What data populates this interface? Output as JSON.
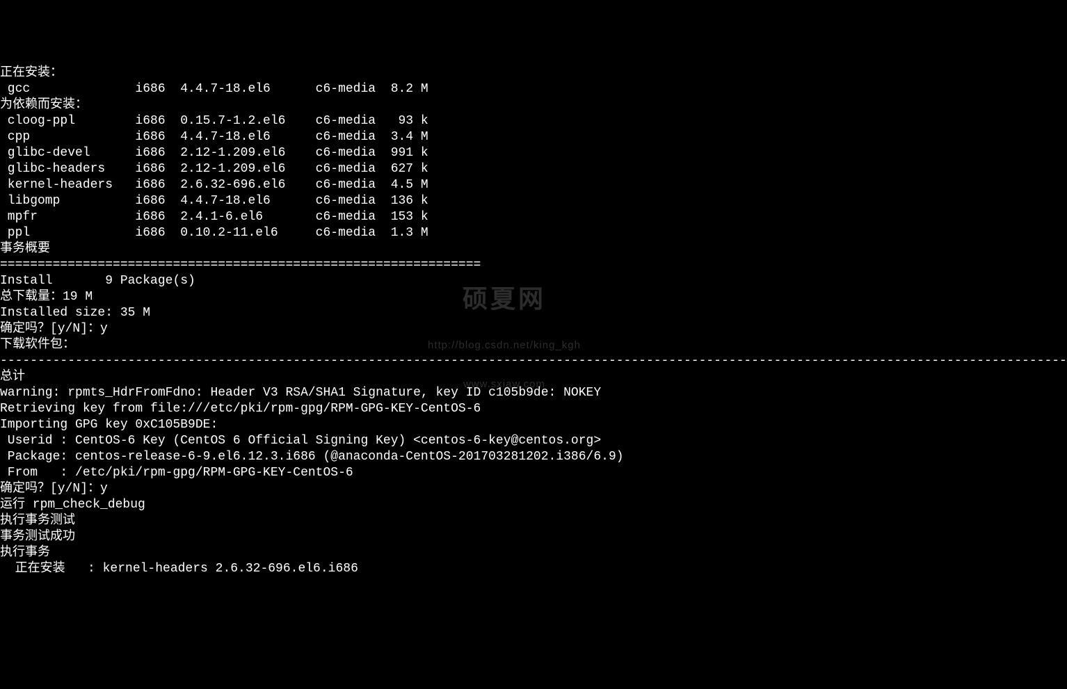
{
  "headers": {
    "installing": "正在安装：",
    "depInstalling": "为依赖而安装：",
    "transactionSummary": "事务概要",
    "total": "总计"
  },
  "pkg_install": [
    {
      "name": "gcc",
      "arch": "i686",
      "version": "4.4.7-18.el6",
      "repo": "c6-media",
      "size": "8.2 M"
    }
  ],
  "pkg_deps": [
    {
      "name": "cloog-ppl",
      "arch": "i686",
      "version": "0.15.7-1.2.el6",
      "repo": "c6-media",
      "size": " 93 k"
    },
    {
      "name": "cpp",
      "arch": "i686",
      "version": "4.4.7-18.el6",
      "repo": "c6-media",
      "size": "3.4 M"
    },
    {
      "name": "glibc-devel",
      "arch": "i686",
      "version": "2.12-1.209.el6",
      "repo": "c6-media",
      "size": "991 k"
    },
    {
      "name": "glibc-headers",
      "arch": "i686",
      "version": "2.12-1.209.el6",
      "repo": "c6-media",
      "size": "627 k"
    },
    {
      "name": "kernel-headers",
      "arch": "i686",
      "version": "2.6.32-696.el6",
      "repo": "c6-media",
      "size": "4.5 M"
    },
    {
      "name": "libgomp",
      "arch": "i686",
      "version": "4.4.7-18.el6",
      "repo": "c6-media",
      "size": "136 k"
    },
    {
      "name": "mpfr",
      "arch": "i686",
      "version": "2.4.1-6.el6",
      "repo": "c6-media",
      "size": "153 k"
    },
    {
      "name": "ppl",
      "arch": "i686",
      "version": "0.10.2-11.el6",
      "repo": "c6-media",
      "size": "1.3 M"
    }
  ],
  "summary": {
    "divider": "================================================================",
    "install_line": "Install       9 Package(s)",
    "download_total": "总下载量：19 M",
    "installed_size": "Installed size: 35 M",
    "confirm1": "确定吗？[y/N]：y",
    "downloading": "下载软件包：",
    "dashes": "--------------------------------------------------------------------------------------------------------------------------------------------------------------------"
  },
  "gpg": {
    "warning": "warning: rpmts_HdrFromFdno: Header V3 RSA/SHA1 Signature, key ID c105b9de: NOKEY",
    "retrieving": "Retrieving key from file:///etc/pki/rpm-gpg/RPM-GPG-KEY-CentOS-6",
    "importing": "Importing GPG key 0xC105B9DE:",
    "userid": " Userid : CentOS-6 Key (CentOS 6 Official Signing Key) <centos-6-key@centos.org>",
    "package": " Package: centos-release-6-9.el6.12.3.i686 (@anaconda-CentOS-201703281202.i386/6.9)",
    "from": " From   : /etc/pki/rpm-gpg/RPM-GPG-KEY-CentOS-6",
    "confirm2": "确定吗？[y/N]：y",
    "run_check": "运行 rpm_check_debug",
    "exec_test": "执行事务测试",
    "test_ok": "事务测试成功",
    "exec_trans": "执行事务",
    "installing_pkg": "  正在安装   : kernel-headers 2.6.32-696.el6.i686"
  },
  "watermark": {
    "title": "硕夏网",
    "url1": "http://blog.csdn.net/king_kgh",
    "url2": "www.sxiaw.com"
  }
}
